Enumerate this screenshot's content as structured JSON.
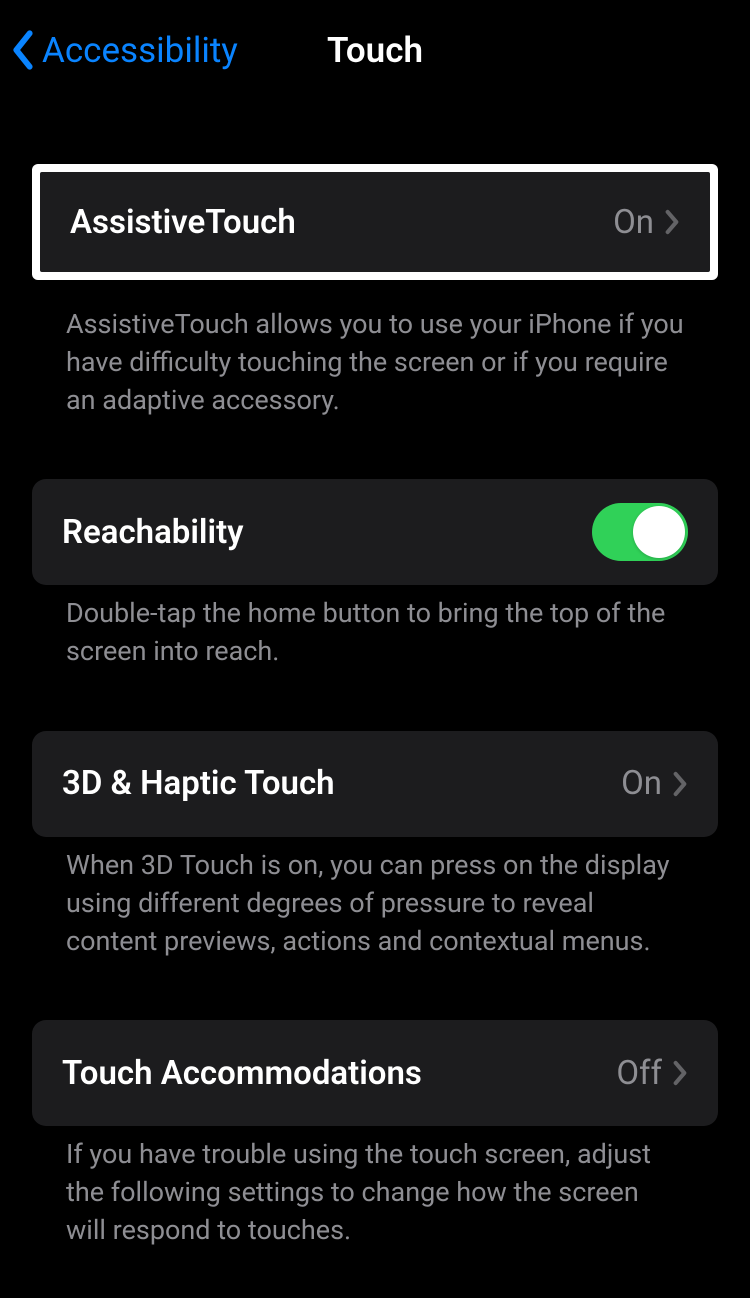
{
  "header": {
    "back_label": "Accessibility",
    "title": "Touch"
  },
  "sections": {
    "assistive": {
      "label": "AssistiveTouch",
      "value": "On",
      "footer": "AssistiveTouch allows you to use your iPhone if you have difficulty touching the screen or if you require an adaptive accessory."
    },
    "reachability": {
      "label": "Reachability",
      "footer": "Double-tap the home button to bring the top of the screen into reach."
    },
    "haptic": {
      "label": "3D & Haptic Touch",
      "value": "On",
      "footer": "When 3D Touch is on, you can press on the display using different degrees of pressure to reveal content previews, actions and contextual menus."
    },
    "accommodations": {
      "label": "Touch Accommodations",
      "value": "Off",
      "footer": "If you have trouble using the touch screen, adjust the following settings to change how the screen will respond to touches."
    }
  }
}
